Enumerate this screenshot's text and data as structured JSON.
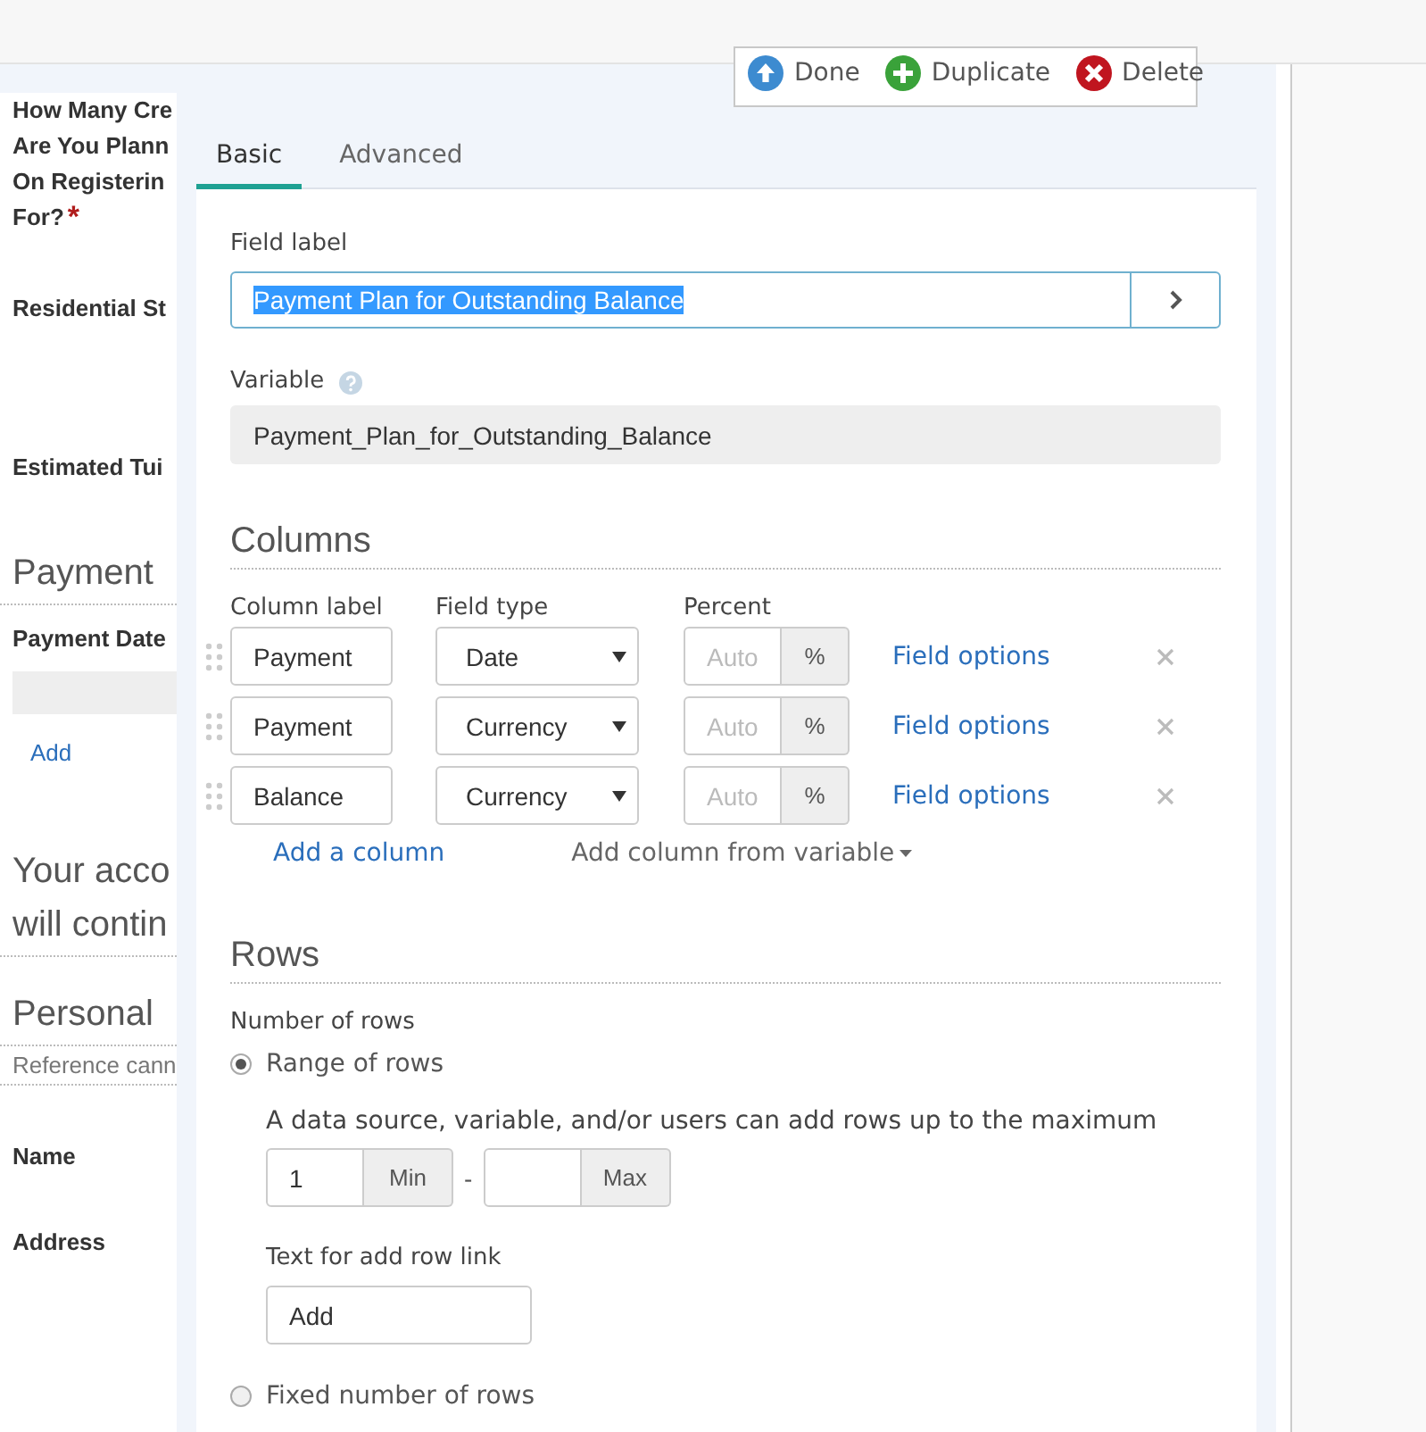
{
  "toolbar": [
    {
      "kind": "done",
      "label": "Done"
    },
    {
      "kind": "duplicate",
      "label": "Duplicate"
    },
    {
      "kind": "delete",
      "label": "Delete"
    }
  ],
  "background_form": [
    {
      "kind": "question",
      "lines": [
        "How Many Cre",
        "Are You Plann",
        "On Registerin",
        "For?"
      ],
      "mark": "*"
    },
    {
      "kind": "label",
      "lines": [
        "Residential St"
      ]
    },
    {
      "kind": "label",
      "lines": [
        "Estimated Tui"
      ]
    },
    {
      "kind": "heading",
      "lines": [
        "Payment"
      ]
    },
    {
      "kind": "label",
      "lines": [
        "Payment Date"
      ]
    },
    {
      "kind": "field"
    },
    {
      "kind": "link",
      "lines": [
        "Add"
      ]
    },
    {
      "kind": "heading",
      "lines": [
        "Your acco",
        "will contin"
      ]
    },
    {
      "kind": "heading",
      "lines": [
        "Personal"
      ]
    },
    {
      "kind": "note",
      "lines": [
        "Reference cann"
      ]
    },
    {
      "kind": "label",
      "lines": [
        "Name"
      ]
    },
    {
      "kind": "label",
      "lines": [
        "Address"
      ]
    }
  ],
  "tabs": [
    {
      "label": "Basic",
      "selected": true
    },
    {
      "label": "Advanced",
      "selected": false
    }
  ],
  "field_label": {
    "label": "Field label",
    "value": "Payment Plan for Outstanding Balance",
    "text_selected": true
  },
  "variable": {
    "label": "Variable",
    "value": "Payment_Plan_for_Outstanding_Balance"
  },
  "columns": {
    "title": "Columns",
    "headers": [
      "Column label",
      "Field type",
      "Percent"
    ],
    "rows": [
      {
        "label": "Payment",
        "field_type": "Date",
        "percent_placeholder": "Auto",
        "percent_unit": "%",
        "options_link": "Field options"
      },
      {
        "label": "Payment",
        "field_type": "Currency",
        "percent_placeholder": "Auto",
        "percent_unit": "%",
        "options_link": "Field options"
      },
      {
        "label": "Balance",
        "field_type": "Currency",
        "percent_placeholder": "Auto",
        "percent_unit": "%",
        "options_link": "Field options"
      }
    ],
    "add_link": "Add a column",
    "add_from_variable": "Add column from variable"
  },
  "rows": {
    "title": "Rows",
    "number_label": "Number of rows",
    "options": [
      {
        "label": "Range of rows",
        "selected": true
      },
      {
        "label": "Fixed number of rows",
        "selected": false
      }
    ],
    "range": {
      "description": "A data source, variable, and/or users can add rows up to the maximum",
      "min_value": "1",
      "min_label": "Min",
      "separator": "-",
      "max_label": "Max"
    },
    "add_row_text": {
      "label": "Text for add row link",
      "value": "Add"
    }
  }
}
